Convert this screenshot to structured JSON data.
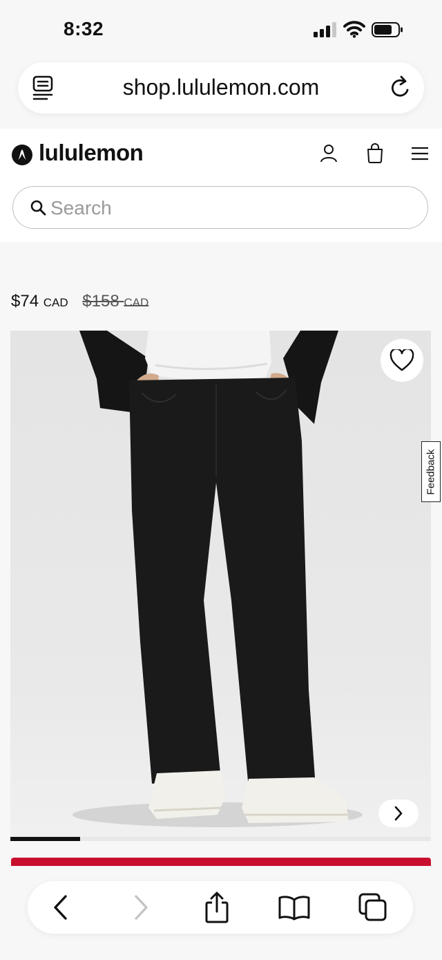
{
  "status_bar": {
    "time": "8:32"
  },
  "browser": {
    "url": "shop.lululemon.com"
  },
  "header": {
    "brand": "lululemon"
  },
  "search": {
    "placeholder": "Search",
    "value": ""
  },
  "product": {
    "price_current": "$74",
    "price_current_currency": "CAD",
    "price_original": "$158",
    "price_original_currency": "CAD",
    "gallery_progress": 0.166
  },
  "feedback": {
    "label": "Feedback"
  },
  "colors": {
    "brand_red": "#c8102e",
    "text": "#111111",
    "image_bg": "#e6e6e6"
  },
  "icons": [
    "reader-icon",
    "reload-icon",
    "lululemon-logo",
    "account-icon",
    "bag-icon",
    "menu-icon",
    "search-icon",
    "heart-icon",
    "chevron-right-icon",
    "back-icon",
    "forward-icon",
    "share-icon",
    "bookmarks-icon",
    "tabs-icon"
  ]
}
